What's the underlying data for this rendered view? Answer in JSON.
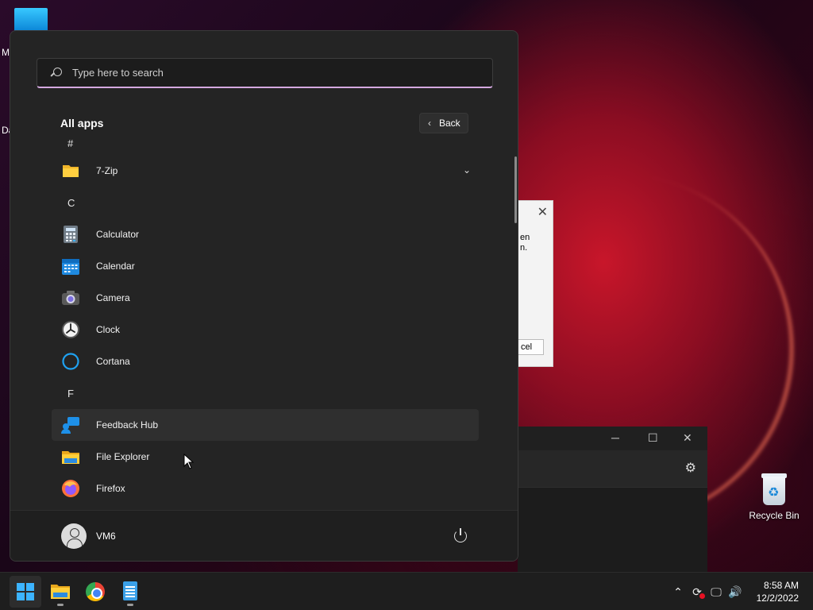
{
  "desktop": {
    "left_letters": [
      "M",
      "Da"
    ],
    "recycle_bin_label": "Recycle Bin"
  },
  "background_dialog": {
    "text_line1": "en",
    "text_line2": "n.",
    "button_label": "cel"
  },
  "start_menu": {
    "search_placeholder": "Type here to search",
    "all_apps_title": "All apps",
    "back_label": "Back",
    "sections": [
      {
        "letter": "#",
        "apps": [
          {
            "name": "7-Zip",
            "icon": "folder-icon",
            "expandable": true
          }
        ]
      },
      {
        "letter": "C",
        "apps": [
          {
            "name": "Calculator",
            "icon": "calculator-icon"
          },
          {
            "name": "Calendar",
            "icon": "calendar-icon"
          },
          {
            "name": "Camera",
            "icon": "camera-icon"
          },
          {
            "name": "Clock",
            "icon": "clock-icon"
          },
          {
            "name": "Cortana",
            "icon": "cortana-icon"
          }
        ]
      },
      {
        "letter": "F",
        "apps": [
          {
            "name": "Feedback Hub",
            "icon": "feedback-hub-icon",
            "hovered": true
          },
          {
            "name": "File Explorer",
            "icon": "file-explorer-icon"
          },
          {
            "name": "Firefox",
            "icon": "firefox-icon"
          }
        ]
      }
    ],
    "user_name": "VM6"
  },
  "taskbar": {
    "pinned": [
      "start-button",
      "file-explorer",
      "chrome",
      "notepad"
    ],
    "clock_time": "8:58 AM",
    "clock_date": "12/2/2022"
  },
  "colors": {
    "accent": "#3cb4ff",
    "search_underline": "#d4a8e0",
    "menu_bg": "#242424"
  }
}
